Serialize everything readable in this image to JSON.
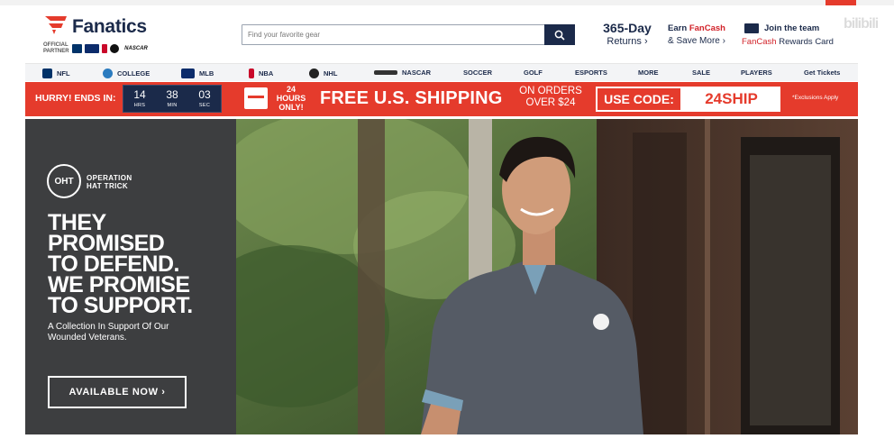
{
  "header": {
    "brand": "Fanatics",
    "partner_label": "OFFICIAL PARTNER",
    "partner_leagues": [
      "NFL",
      "MLB",
      "NBA",
      "NHL",
      "NASCAR"
    ],
    "search": {
      "placeholder": "Find your favorite gear"
    },
    "promo_returns": {
      "title": "365-Day",
      "subtitle": "Returns ›"
    },
    "promo_fancash": {
      "line1_prefix": "Earn ",
      "line1_brand": "FanCash",
      "line2": "& Save More ›"
    },
    "promo_card": {
      "line1": "Join the team",
      "line2_brand": "FanCash",
      "line2_rest": " Rewards Card"
    },
    "watermark": "bilibili"
  },
  "nav": {
    "items": [
      {
        "label": "NFL",
        "icon": "nfl-icon"
      },
      {
        "label": "COLLEGE",
        "icon": "college-icon"
      },
      {
        "label": "MLB",
        "icon": "mlb-icon"
      },
      {
        "label": "NBA",
        "icon": "nba-icon"
      },
      {
        "label": "NHL",
        "icon": "nhl-icon"
      },
      {
        "label": "NASCAR",
        "icon": "nascar-icon"
      },
      {
        "label": "SOCCER"
      },
      {
        "label": "GOLF"
      },
      {
        "label": "ESPORTS"
      },
      {
        "label": "MORE"
      },
      {
        "label": "SALE"
      },
      {
        "label": "PLAYERS"
      },
      {
        "label": "Get Tickets"
      }
    ]
  },
  "banner": {
    "hurry": "HURRY! ENDS IN:",
    "timer": [
      {
        "value": "14",
        "unit": "HRS"
      },
      {
        "value": "38",
        "unit": "MIN"
      },
      {
        "value": "03",
        "unit": "SEC"
      }
    ],
    "hours_line1": "24",
    "hours_line2": "HOURS",
    "hours_line3": "ONLY!",
    "free_shipping": "FREE U.S. SHIPPING",
    "orders_line1": "ON ORDERS",
    "orders_line2": "OVER $24",
    "use_code": "USE CODE:",
    "code": "24SHIP",
    "exclusions": "*Exclusions Apply"
  },
  "hero": {
    "badge_text": "OHT",
    "operation_line1": "OPERATION",
    "operation_line2": "HAT TRICK",
    "headline": [
      "THEY",
      "PROMISED",
      "TO DEFEND.",
      "WE PROMISE",
      "TO SUPPORT."
    ],
    "sub_line1": "A Collection In Support Of Our",
    "sub_line2": "Wounded Veterans.",
    "cta": "AVAILABLE NOW ›"
  },
  "colors": {
    "navy": "#1b2a4a",
    "red": "#e53b2c",
    "hero_panel": "#3d3e40"
  }
}
